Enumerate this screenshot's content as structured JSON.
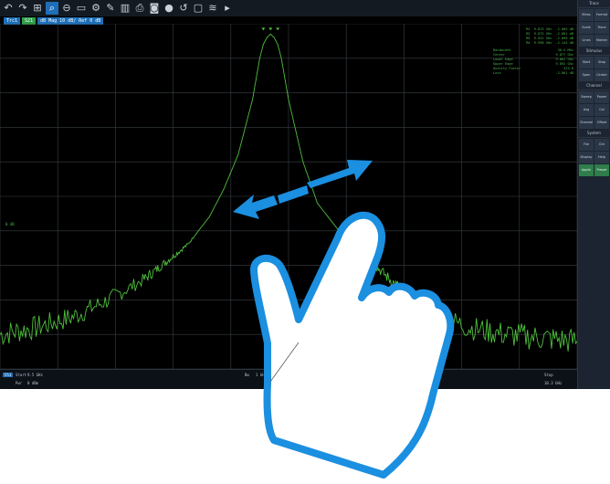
{
  "toolbar": {
    "icons": [
      {
        "name": "undo-icon",
        "glyph": "↶"
      },
      {
        "name": "redo-icon",
        "glyph": "↷"
      },
      {
        "name": "zoom-window-icon",
        "glyph": "⊞"
      },
      {
        "name": "zoom-active-icon",
        "glyph": "⌕",
        "active": true
      },
      {
        "name": "zoom-out-icon",
        "glyph": "⊖"
      },
      {
        "name": "frame-icon",
        "glyph": "▭"
      },
      {
        "name": "settings-icon",
        "glyph": "⚙"
      },
      {
        "name": "wizard-icon",
        "glyph": "✎"
      },
      {
        "name": "layout-icon",
        "glyph": "▥"
      },
      {
        "name": "print-icon",
        "glyph": "⎙"
      },
      {
        "name": "camera-icon",
        "glyph": "◙"
      },
      {
        "name": "marker-icon",
        "glyph": "●"
      },
      {
        "name": "restore-icon",
        "glyph": "↺"
      },
      {
        "name": "display-icon",
        "glyph": "▢"
      },
      {
        "name": "wifi-icon",
        "glyph": "≋"
      },
      {
        "name": "more-icon",
        "glyph": "▸"
      }
    ]
  },
  "info_chips": [
    {
      "text": "Trc1",
      "color": "#1e6fb8"
    },
    {
      "text": "S21",
      "color": "#2e9e4a"
    },
    {
      "text": "dB Mag 10 dB/ Ref 0 dB",
      "color": "#1e6fb8"
    }
  ],
  "markers": [
    "M1  9.813 GHz  -2.085 dB",
    "M2  9.875 GHz  -2.061 dB",
    "M3  9.941 GHz  -2.096 dB",
    "M4  9.998 GHz  -2.144 dB"
  ],
  "marker_info": [
    [
      "Bandwidth",
      "30.5 MHz"
    ],
    [
      "Center",
      "9.877 GHz"
    ],
    [
      "Lower Edge",
      "9.862 GHz"
    ],
    [
      "Upper Edge",
      "9.892 GHz"
    ],
    [
      "Quality Factor",
      "323.8"
    ],
    [
      "Loss",
      "-2.061 dB"
    ]
  ],
  "ref_label": "0 dB",
  "status": {
    "channel": "Ch1",
    "start_label": "Start",
    "start_value": "9.5 GHz",
    "pwr_label": "Pwr",
    "pwr_value": "0 dBm",
    "bw_label": "Bw",
    "bw_value": "1 kHz",
    "stop_label": "Stop",
    "stop_value": "10.3 GHz"
  },
  "sidebar": {
    "sections": [
      {
        "title": "Trace",
        "buttons": [
          "Meas",
          "Format",
          "Scale",
          "Trace Config",
          "Lines",
          "Marker"
        ]
      },
      {
        "title": "Stimulus",
        "buttons": [
          "Start",
          "Stop",
          "Span",
          "Center"
        ]
      },
      {
        "title": "Channel",
        "buttons": [
          "Sweep",
          "Power",
          "Avg",
          "Cal",
          "Channel Config",
          "Offset"
        ]
      },
      {
        "title": "System",
        "buttons": [
          "File",
          "Ctrl",
          "Display",
          "Help",
          "Applic",
          "Preset"
        ]
      }
    ]
  },
  "colors": {
    "trace": "#4fbf3c",
    "grid": "#3a3f44",
    "arrow": "#1b8fe0",
    "hand_outline": "#1b8fe0"
  },
  "chart_data": {
    "type": "line",
    "title": "",
    "xlabel": "",
    "ylabel": "",
    "xlim": [
      9.5,
      10.3
    ],
    "ylim": [
      -100,
      0
    ],
    "grid": true,
    "series": [
      {
        "x": [
          9.5,
          9.55,
          9.6,
          9.65,
          9.7,
          9.73,
          9.76,
          9.79,
          9.81,
          9.83,
          9.85,
          9.86,
          9.865,
          9.87,
          9.875,
          9.88,
          9.885,
          9.89,
          9.9,
          9.92,
          9.94,
          9.97,
          10.0,
          10.03,
          10.06,
          10.1,
          10.15,
          10.2,
          10.25,
          10.3
        ],
        "values": [
          -90,
          -88,
          -85,
          -80,
          -74,
          -69,
          -64,
          -56,
          -48,
          -38,
          -22,
          -10,
          -6,
          -4,
          -3,
          -4,
          -6,
          -10,
          -22,
          -40,
          -52,
          -60,
          -66,
          -72,
          -78,
          -84,
          -88,
          -90,
          -91,
          -92
        ]
      }
    ]
  }
}
